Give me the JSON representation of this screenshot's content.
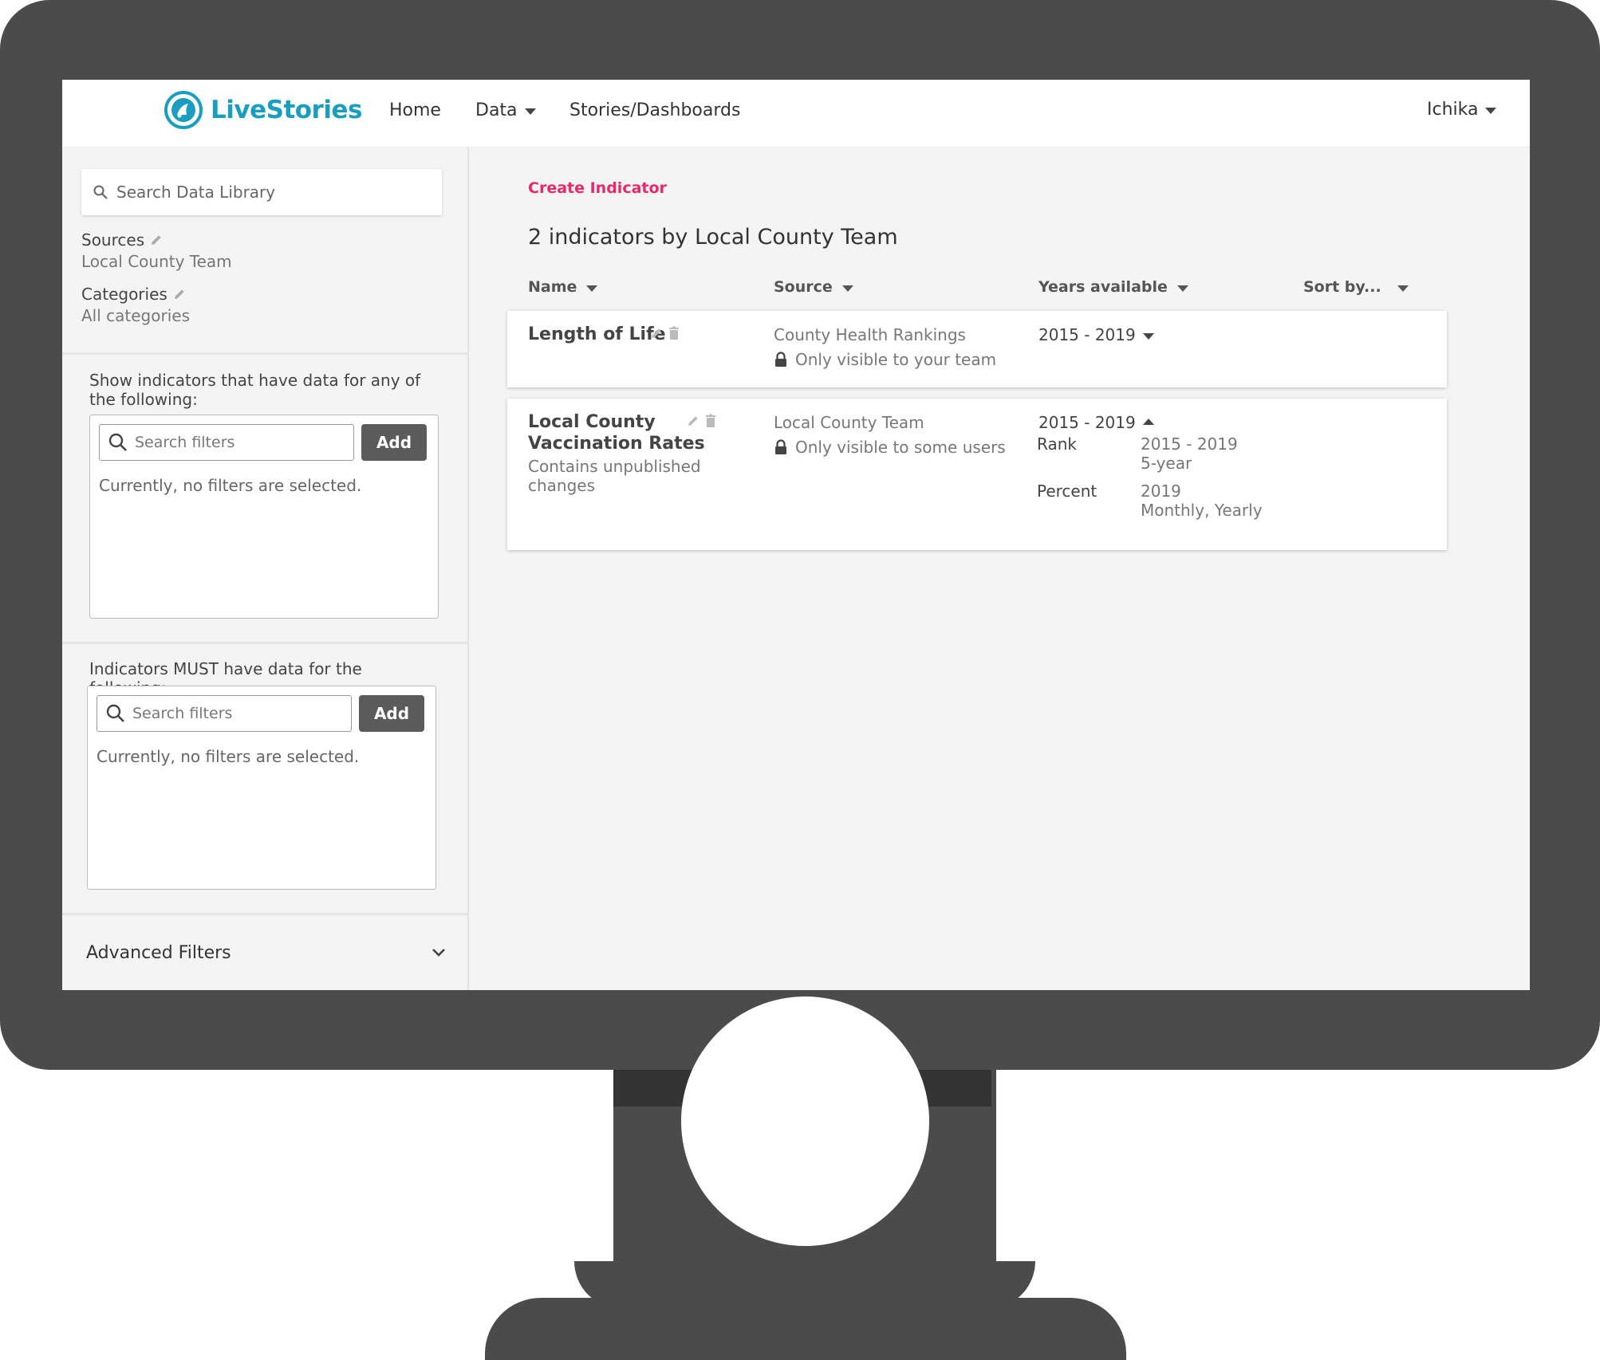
{
  "brand": {
    "name": "LiveStories",
    "color": "#1a9dbf"
  },
  "nav": {
    "items": [
      {
        "label": "Home",
        "icon": ""
      },
      {
        "label": "Data",
        "icon": "caret-down-icon"
      },
      {
        "label": "Stories/Dashboards",
        "icon": ""
      }
    ],
    "user": {
      "name": "Ichika",
      "icon": "caret-down-icon"
    }
  },
  "sidebar": {
    "library_search_placeholder": "Search Data Library",
    "sources": {
      "label": "Sources",
      "value": "Local County Team"
    },
    "categories": {
      "label": "Categories",
      "value": "All categories"
    },
    "any_filter": {
      "title": "Show indicators that have data for any of the following:",
      "search_placeholder": "Search filters",
      "add_label": "Add",
      "empty_text": "Currently, no filters are selected."
    },
    "must_filter": {
      "title": "Indicators MUST have data for the following:",
      "search_placeholder": "Search filters",
      "add_label": "Add",
      "empty_text": "Currently, no filters are selected."
    },
    "advanced_label": "Advanced Filters"
  },
  "main": {
    "create_label": "Create Indicator",
    "accent_color": "#e8286b",
    "heading": "2 indicators by Local County Team",
    "columns": [
      "Name",
      "Source",
      "Years available",
      "Sort by..."
    ],
    "indicators": [
      {
        "name": "Length of Life",
        "source": "County Health Rankings",
        "visibility": "Only visible to your team",
        "years": "2015 - 2019"
      },
      {
        "name_line1": "Local County",
        "name_line2": "Vaccination Rates",
        "note_line1": "Contains unpublished",
        "note_line2": "changes",
        "source": "Local County Team",
        "visibility": "Only visible to some users",
        "years": "2015 - 2019",
        "measures": [
          {
            "label": "Rank",
            "years": "2015 - 2019",
            "frequency": "5-year"
          },
          {
            "label": "Percent",
            "years": "2019",
            "frequency": "Monthly, Yearly"
          }
        ]
      }
    ]
  }
}
